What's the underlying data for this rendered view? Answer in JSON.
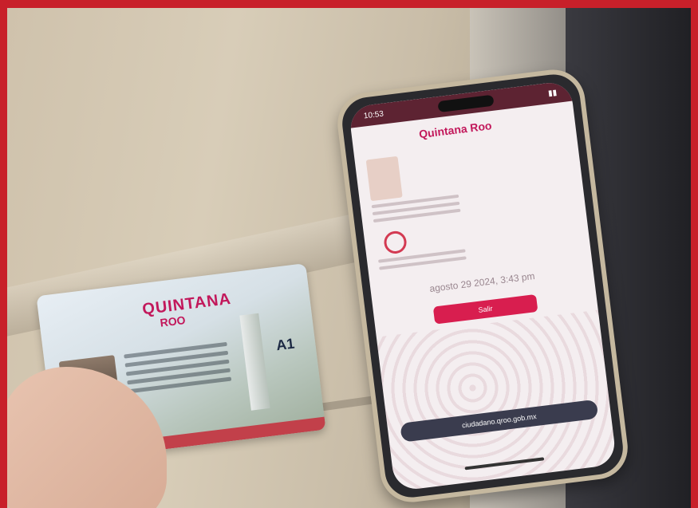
{
  "card": {
    "logo_text": "QUINTANA",
    "logo_sub": "ROO",
    "license_class": "A1"
  },
  "phone": {
    "status_time": "10:53",
    "app_logo": "Quintana Roo",
    "date_text": "agosto 29 2024, 3:43 pm",
    "button_label": "Salir",
    "url_text": "ciudadano.qroo.gob.mx"
  }
}
